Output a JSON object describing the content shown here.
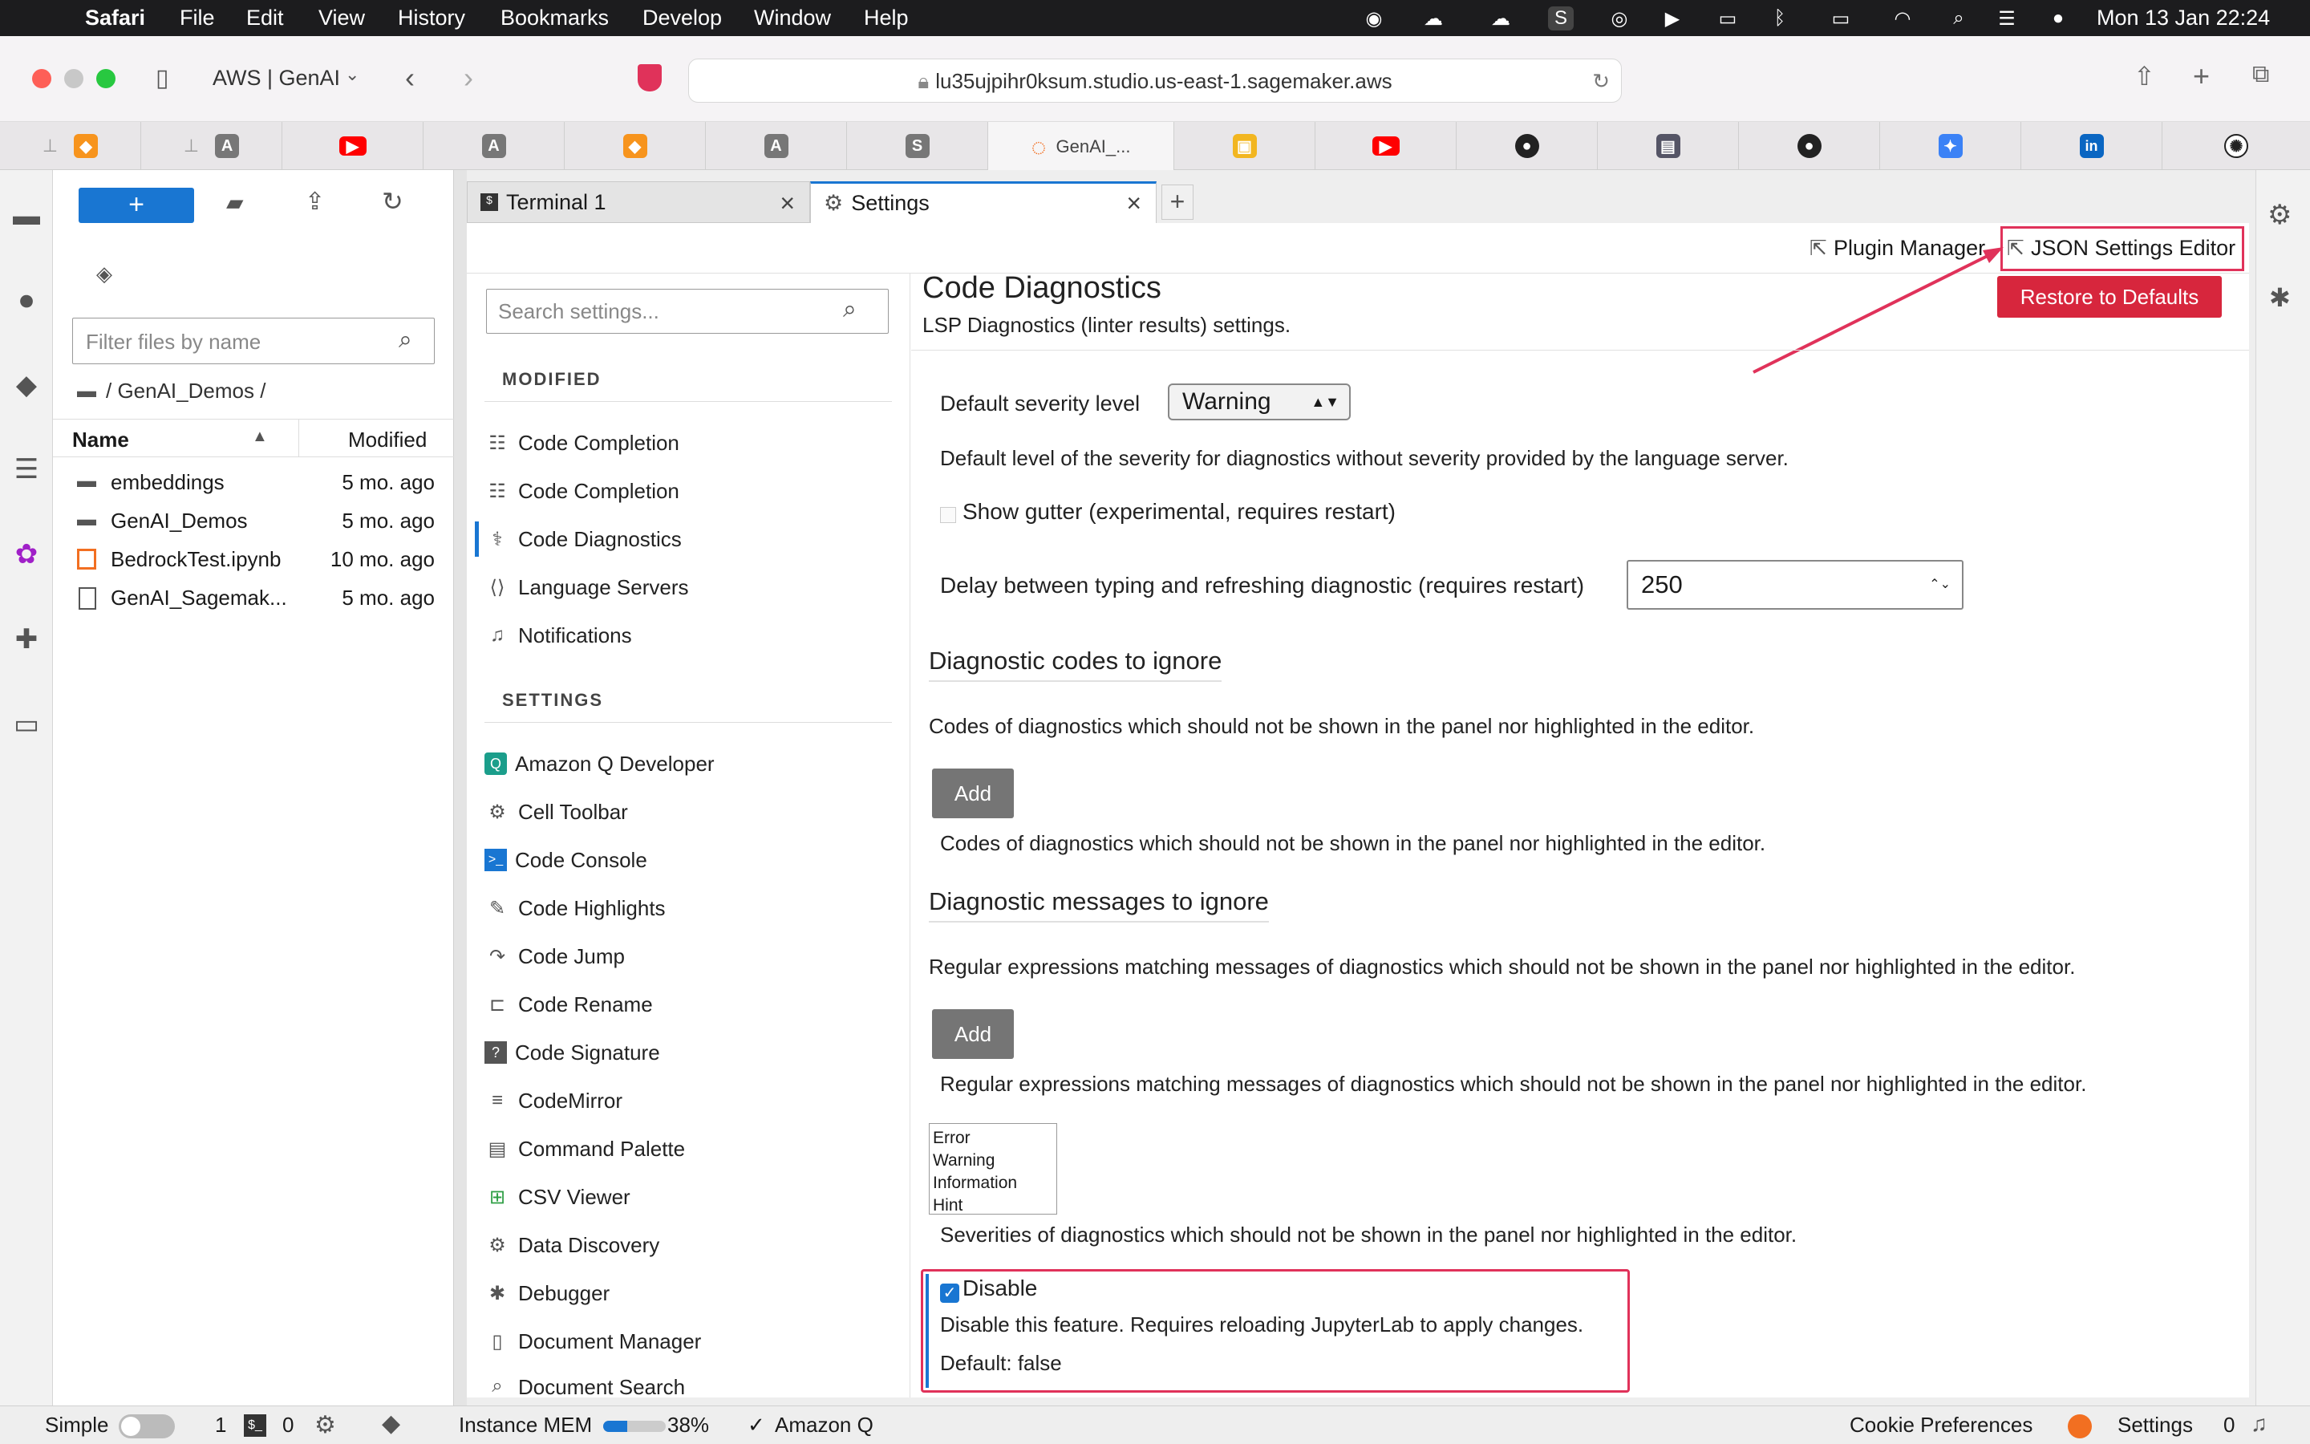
{
  "menubar": {
    "app": "Safari",
    "items": [
      "File",
      "Edit",
      "View",
      "History",
      "Bookmarks",
      "Develop",
      "Window",
      "Help"
    ],
    "clock": "Mon 13 Jan  22:24"
  },
  "toolbar": {
    "profile": "AWS | GenAI",
    "url": "lu35ujpihr0ksum.studio.us-east-1.sagemaker.aws"
  },
  "browser_tabs": {
    "active_label": "GenAI_..."
  },
  "file_panel": {
    "new_label": "+",
    "filter_placeholder": "Filter files by name",
    "breadcrumb": "/ GenAI_Demos /",
    "col_name": "Name",
    "col_modified": "Modified",
    "files": [
      {
        "name": "embeddings",
        "modified": "5 mo. ago"
      },
      {
        "name": "GenAI_Demos",
        "modified": "5 mo. ago"
      },
      {
        "name": "BedrockTest.ipynb",
        "modified": "10 mo. ago"
      },
      {
        "name": "GenAI_Sagemak...",
        "modified": "5 mo. ago"
      }
    ]
  },
  "tabs": {
    "terminal": "Terminal 1",
    "settings": "Settings",
    "close": "×",
    "add": "+"
  },
  "settings": {
    "plugin_manager": "Plugin Manager",
    "json_editor": "JSON Settings Editor",
    "restore": "Restore to Defaults",
    "search_placeholder": "Search settings...",
    "modified_heading": "MODIFIED",
    "settings_heading": "SETTINGS",
    "modified_items": [
      "Code Completion",
      "Code Completion",
      "Code Diagnostics",
      "Language Servers",
      "Notifications"
    ],
    "settings_items": [
      "Amazon Q Developer",
      "Cell Toolbar",
      "Code Console",
      "Code Highlights",
      "Code Jump",
      "Code Rename",
      "Code Signature",
      "CodeMirror",
      "Command Palette",
      "CSV Viewer",
      "Data Discovery",
      "Debugger",
      "Document Manager",
      "Document Search"
    ],
    "title": "Code Diagnostics",
    "subtitle": "LSP Diagnostics (linter results) settings.",
    "severity_label": "Default severity level",
    "severity_value": "Warning",
    "severity_desc": "Default level of the severity for diagnostics without severity provided by the language server.",
    "gutter_label": "Show gutter (experimental, requires restart)",
    "delay_label": "Delay between typing and refreshing diagnostic (requires restart)",
    "delay_value": "250",
    "codes_heading": "Diagnostic codes to ignore",
    "codes_desc": "Codes of diagnostics which should not be shown in the panel nor highlighted in the editor.",
    "add_label": "Add",
    "messages_heading": "Diagnostic messages to ignore",
    "messages_desc": "Regular expressions matching messages of diagnostics which should not be shown in the panel nor highlighted in the editor.",
    "severities_options": [
      "Error",
      "Warning",
      "Information",
      "Hint"
    ],
    "severities_desc": "Severities of diagnostics which should not be shown in the panel nor highlighted in the editor.",
    "disable_label": "Disable",
    "disable_desc": "Disable this feature. Requires reloading JupyterLab to apply changes.",
    "disable_default": "Default: false"
  },
  "statusbar": {
    "simple": "Simple",
    "count1": "1",
    "count2": "0",
    "mem": "Instance MEM",
    "mem_pct": "38%",
    "mem_level": 0.38,
    "amazonq": "Amazon Q",
    "cookie": "Cookie Preferences",
    "settings": "Settings",
    "notif_count": "0"
  },
  "colors": {
    "accent_blue": "#1976d2",
    "restore_red": "#d7263d",
    "highlight_pink": "#e0325a",
    "add_gray": "#757575"
  }
}
